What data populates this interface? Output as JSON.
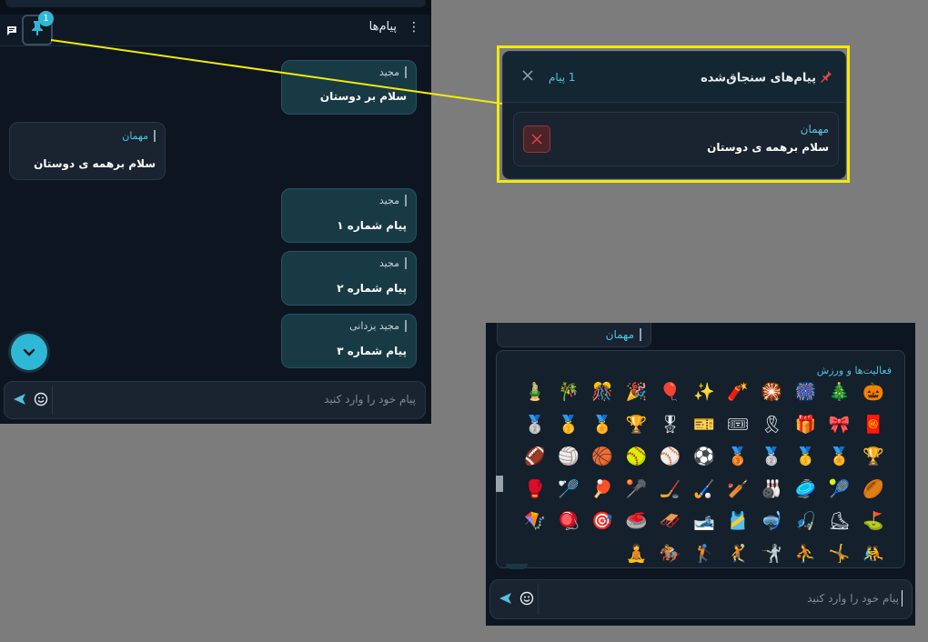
{
  "chat": {
    "title": "پیام‌ها",
    "menu_glyph": "⋮",
    "pin_count": "1",
    "messages": [
      {
        "sender": "مجید",
        "text": "سلام بر دوستان",
        "side": "me"
      },
      {
        "sender": "مهمان",
        "text": "سلام برهمه ی دوستان",
        "side": "them"
      },
      {
        "sender": "مجید",
        "text": "پیام شماره ۱",
        "side": "me"
      },
      {
        "sender": "مجید",
        "text": "پیام شماره ۲",
        "side": "me"
      },
      {
        "sender": "مجید یزدانی",
        "text": "پیام شماره ۳",
        "side": "me"
      }
    ],
    "input_placeholder": "پیام خود را وارد کنید"
  },
  "pinned": {
    "title": "پیام‌های سنجاق‌شده",
    "count": "1 پیام",
    "item": {
      "sender": "مهمان",
      "text": "سلام برهمه ی دوستان"
    }
  },
  "emoji_window": {
    "guest_name": "مهمان",
    "category_label": "فعالیت‌ها و ورزش",
    "rows": [
      [
        "🎃",
        "🎄",
        "🎆",
        "🎇",
        "🧨",
        "✨",
        "🎈",
        "🎉",
        "🎊",
        "🎋",
        "🎍"
      ],
      [
        "🧧",
        "🎀",
        "🎁",
        "🎗",
        "🎟",
        "🎫",
        "🎖",
        "🏆",
        "🏅",
        "🥇",
        "🥈"
      ],
      [
        "🏆",
        "🏅",
        "🥇",
        "🥈",
        "🥉",
        "⚽",
        "⚾",
        "🥎",
        "🏀",
        "🏐",
        "🏈"
      ],
      [
        "🏉",
        "🎾",
        "🥏",
        "🎳",
        "🏏",
        "🏑",
        "🏒",
        "🥍",
        "🏓",
        "🏸",
        "🥊"
      ],
      [
        "⛳",
        "⛸",
        "🎣",
        "🤿",
        "🎽",
        "🎿",
        "🛷",
        "🥌",
        "🎯",
        "🪀",
        "🪁"
      ],
      [
        "🤼",
        "🤸",
        "⛹",
        "🤺",
        "🤾",
        "🏌",
        "🏇",
        "🧘"
      ]
    ],
    "input_placeholder": "پیام خود را وارد کنید"
  },
  "colors": {
    "accent": "#2fb7d6",
    "highlight": "#f2ea0a",
    "background": "#0d1520"
  },
  "icons": [
    "pin-icon",
    "chat-bubble-icon",
    "kebab-menu-icon",
    "chevron-down-icon",
    "send-icon",
    "smiley-icon",
    "close-icon",
    "pushpin-icon"
  ]
}
